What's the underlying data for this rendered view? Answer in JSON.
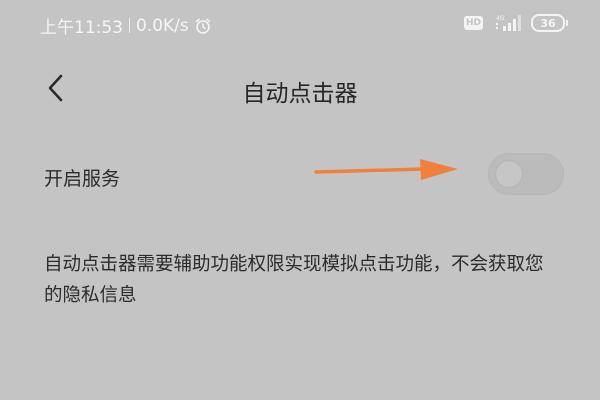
{
  "status_bar": {
    "time": "上午11:53",
    "network_speed": "0.0K/s",
    "alarm_icon": "alarm-clock-icon",
    "hd_label": "HD",
    "signal_label": "4G",
    "battery_level": "36"
  },
  "header": {
    "back_icon": "chevron-left-icon",
    "title": "自动点击器"
  },
  "setting": {
    "label": "开启服务",
    "enabled": false
  },
  "annotation": {
    "arrow_color": "#f0803c"
  },
  "description": "自动点击器需要辅助功能权限实现模拟点击功能，不会获取您的隐私信息"
}
